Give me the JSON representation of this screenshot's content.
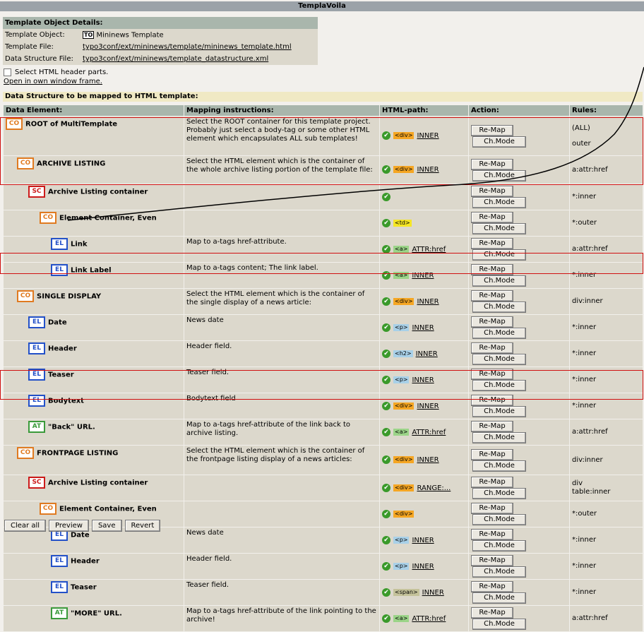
{
  "window": {
    "title": "TemplaVoila"
  },
  "details": {
    "heading": "Template Object Details:",
    "rows": [
      {
        "label": "Template Object:",
        "value": "Mininews Template",
        "icon": "template-object-icon",
        "icon_text": "TO"
      },
      {
        "label": "Template File:",
        "value": "typo3conf/ext/mininews/template/mininews_template.html"
      },
      {
        "label": "Data Structure File:",
        "value": "typo3conf/ext/mininews/template_datastructure.xml"
      }
    ]
  },
  "options": {
    "header_parts_label": "Select HTML header parts.",
    "open_link": "Open in own window frame."
  },
  "mapping": {
    "heading": "Data Structure to be mapped to HTML template:",
    "columns": [
      "Data Element:",
      "Mapping instructions:",
      "HTML-path:",
      "Action:",
      "Rules:"
    ],
    "remap_label": "Re-Map",
    "chmode_label": "Ch.Mode",
    "rows": [
      {
        "type": "CO",
        "indent": 0,
        "name": "ROOT of MultiTemplate",
        "instr": "Select the ROOT container for this template project. Probably just select a body-tag or some other HTML element which encapsulates ALL sub templates!",
        "tag": "div",
        "path": "INNER",
        "rules": "(ALL)",
        "rules2": "outer"
      },
      {
        "type": "CO",
        "indent": 1,
        "name": "ARCHIVE LISTING",
        "instr": "Select the HTML element which is the container of the whole archive listing portion of the template file:",
        "tag": "div",
        "path": "INNER",
        "rules": "a:attr:href"
      },
      {
        "type": "SC",
        "indent": 2,
        "name": "Archive Listing container",
        "instr": "",
        "tag": "",
        "path": "",
        "rules": "*:inner"
      },
      {
        "type": "CO",
        "indent": 3,
        "name": "Element Container, Even",
        "instr": "",
        "tag": "td",
        "path": "",
        "rules": "*:outer"
      },
      {
        "type": "EL",
        "indent": 4,
        "name": "Link",
        "instr": "Map to a-tags href-attribute.",
        "tag": "a",
        "path": "ATTR:href",
        "rules": "a:attr:href"
      },
      {
        "type": "EL",
        "indent": 4,
        "name": "Link Label",
        "instr": "Map to a-tags content; The link label.",
        "tag": "a",
        "path": "INNER",
        "rules": "*:inner"
      },
      {
        "type": "CO",
        "indent": 1,
        "name": "SINGLE DISPLAY",
        "instr": "Select the HTML element which is the container of the single display of a news article:",
        "tag": "div",
        "path": "INNER",
        "rules": "div:inner"
      },
      {
        "type": "EL",
        "indent": 2,
        "name": "Date",
        "instr": "News date",
        "tag": "p",
        "path": "INNER",
        "rules": "*:inner"
      },
      {
        "type": "EL",
        "indent": 2,
        "name": "Header",
        "instr": "Header field.",
        "tag": "h2",
        "path": "INNER",
        "rules": "*:inner"
      },
      {
        "type": "EL",
        "indent": 2,
        "name": "Teaser",
        "instr": "Teaser field.",
        "tag": "p",
        "path": "INNER",
        "rules": "*:inner"
      },
      {
        "type": "EL",
        "indent": 2,
        "name": "Bodytext",
        "instr": "Bodytext field",
        "tag": "div",
        "path": "INNER",
        "rules": "*:inner"
      },
      {
        "type": "AT",
        "indent": 2,
        "name": "\"Back\" URL.",
        "instr": "Map to a-tags href-attribute of the link back to archive listing.",
        "tag": "a",
        "path": "ATTR:href",
        "rules": "a:attr:href"
      },
      {
        "type": "CO",
        "indent": 1,
        "name": "FRONTPAGE LISTING",
        "instr": "Select the HTML element which is the container of the frontpage listing display of a news articles:",
        "tag": "div",
        "path": "INNER",
        "rules": "div:inner"
      },
      {
        "type": "SC",
        "indent": 2,
        "name": "Archive Listing container",
        "instr": "",
        "tag": "div",
        "path": "RANGE:...",
        "rules": "div",
        "rules2": "table:inner"
      },
      {
        "type": "CO",
        "indent": 3,
        "name": "Element Container, Even",
        "instr": "",
        "tag": "div",
        "path": "",
        "rules": "*:outer"
      },
      {
        "type": "EL",
        "indent": 4,
        "name": "Date",
        "instr": "News date",
        "tag": "p",
        "path": "INNER",
        "rules": "*:inner"
      },
      {
        "type": "EL",
        "indent": 4,
        "name": "Header",
        "instr": "Header field.",
        "tag": "p",
        "path": "INNER",
        "rules": "*:inner"
      },
      {
        "type": "EL",
        "indent": 4,
        "name": "Teaser",
        "instr": "Teaser field.",
        "tag": "span",
        "path": "INNER",
        "rules": "*:inner"
      },
      {
        "type": "AT",
        "indent": 4,
        "name": "\"MORE\" URL.",
        "instr": "Map to a-tags href-attribute of the link pointing to the archive!",
        "tag": "a",
        "path": "ATTR:href",
        "rules": "a:attr:href"
      }
    ]
  },
  "footer": {
    "buttons": [
      "Clear all",
      "Preview",
      "Save",
      "Revert"
    ]
  },
  "colors": {
    "annotation_box": "#d01010",
    "annotation_curve": "#000000"
  }
}
